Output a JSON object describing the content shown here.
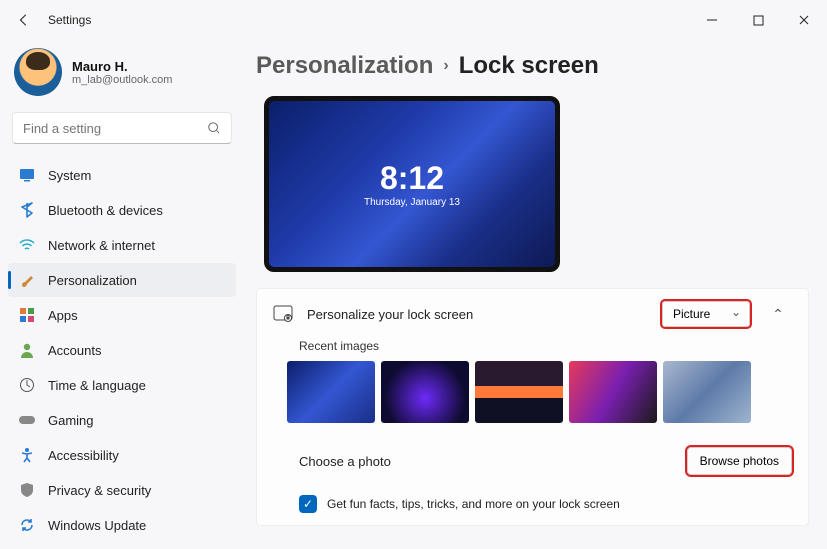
{
  "window": {
    "title": "Settings"
  },
  "user": {
    "name": "Mauro H.",
    "email": "m_lab@outlook.com"
  },
  "search": {
    "placeholder": "Find a setting"
  },
  "nav": {
    "items": [
      {
        "label": "System"
      },
      {
        "label": "Bluetooth & devices"
      },
      {
        "label": "Network & internet"
      },
      {
        "label": "Personalization"
      },
      {
        "label": "Apps"
      },
      {
        "label": "Accounts"
      },
      {
        "label": "Time & language"
      },
      {
        "label": "Gaming"
      },
      {
        "label": "Accessibility"
      },
      {
        "label": "Privacy & security"
      },
      {
        "label": "Windows Update"
      }
    ]
  },
  "breadcrumb": {
    "parent": "Personalization",
    "current": "Lock screen"
  },
  "preview": {
    "time": "8:12",
    "date": "Thursday, January 13"
  },
  "personalize": {
    "label": "Personalize your lock screen",
    "dropdown_value": "Picture",
    "recent_label": "Recent images",
    "choose_label": "Choose a photo",
    "browse_label": "Browse photos",
    "fun_facts_label": "Get fun facts, tips, tricks, and more on your lock screen"
  }
}
